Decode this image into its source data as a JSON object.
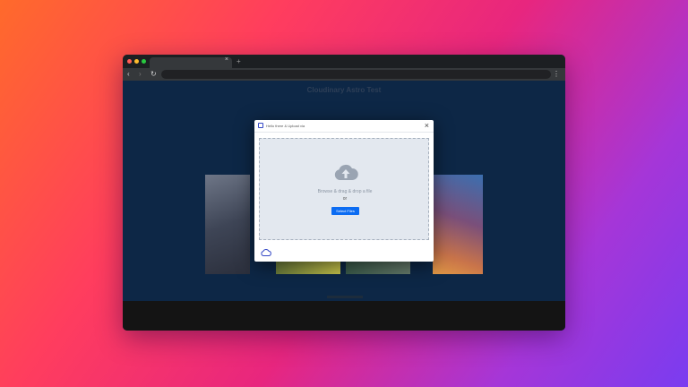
{
  "browser": {
    "tab_close": "×",
    "new_tab": "+",
    "back": "‹",
    "forward": "›",
    "reload": "↻",
    "menu": "⋮",
    "traffic_lights": [
      "#ff5f57",
      "#febc2e",
      "#28c840"
    ]
  },
  "page": {
    "title": "Cloudinary Astro Test"
  },
  "modal": {
    "title": "Hello there & Upload via",
    "close": "×",
    "drop_text": "Browse & drag & drop a file",
    "or_text": "or",
    "select_button": "Select Files",
    "icons": {
      "upload": "cloud-upload-icon",
      "footer": "cloud-logo-icon",
      "close": "close-icon"
    },
    "accent": "#0c6cf2"
  }
}
